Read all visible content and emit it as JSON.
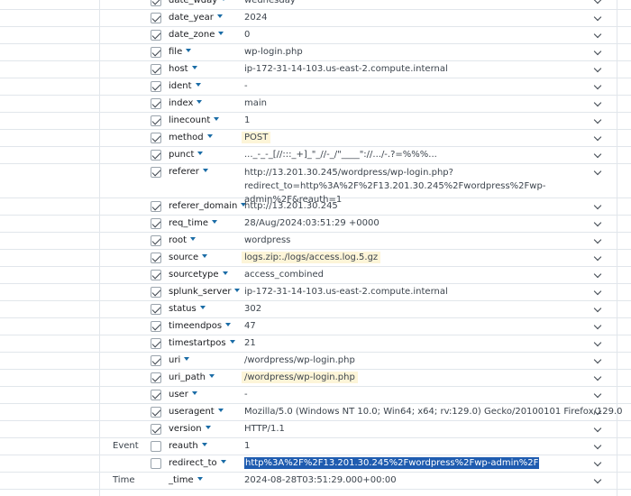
{
  "fields": [
    {
      "name": "date_wday",
      "value": "wednesday",
      "checked": true
    },
    {
      "name": "date_year",
      "value": "2024",
      "checked": true
    },
    {
      "name": "date_zone",
      "value": "0",
      "checked": true
    },
    {
      "name": "file",
      "value": "wp-login.php",
      "checked": true
    },
    {
      "name": "host",
      "value": "ip-172-31-14-103.us-east-2.compute.internal",
      "checked": true
    },
    {
      "name": "ident",
      "value": "-",
      "checked": true
    },
    {
      "name": "index",
      "value": "main",
      "checked": true
    },
    {
      "name": "linecount",
      "value": "1",
      "checked": true
    },
    {
      "name": "method",
      "value": "POST",
      "checked": true,
      "highlight": true
    },
    {
      "name": "punct",
      "value": "..._-_-_[//:::_+]_\"_//-_/\"____\"://.../-.?=%%%...",
      "checked": true
    },
    {
      "name": "referer",
      "value": "http://13.201.30.245/wordpress/wp-login.php?redirect_to=http%3A%2F%2F13.201.30.245%2Fwordpress%2Fwp-admin%2F&reauth=1",
      "checked": true,
      "tall": true
    },
    {
      "name": "referer_domain",
      "value": "http://13.201.30.245",
      "checked": true
    },
    {
      "name": "req_time",
      "value": "28/Aug/2024:03:51:29 +0000",
      "checked": true
    },
    {
      "name": "root",
      "value": "wordpress",
      "checked": true
    },
    {
      "name": "source",
      "value": "logs.zip:./logs/access.log.5.gz",
      "checked": true,
      "highlight": true
    },
    {
      "name": "sourcetype",
      "value": "access_combined",
      "checked": true
    },
    {
      "name": "splunk_server",
      "value": "ip-172-31-14-103.us-east-2.compute.internal",
      "checked": true
    },
    {
      "name": "status",
      "value": "302",
      "checked": true
    },
    {
      "name": "timeendpos",
      "value": "47",
      "checked": true
    },
    {
      "name": "timestartpos",
      "value": "21",
      "checked": true
    },
    {
      "name": "uri",
      "value": "/wordpress/wp-login.php",
      "checked": true
    },
    {
      "name": "uri_path",
      "value": "/wordpress/wp-login.php",
      "checked": true,
      "highlight": true
    },
    {
      "name": "user",
      "value": "-",
      "checked": true
    },
    {
      "name": "useragent",
      "value": "Mozilla/5.0 (Windows NT 10.0; Win64; x64; rv:129.0) Gecko/20100101 Firefox/129.0",
      "checked": true
    },
    {
      "name": "version",
      "value": "HTTP/1.1",
      "checked": true
    }
  ],
  "event_section": {
    "label": "Event",
    "fields": [
      {
        "name": "reauth",
        "value": "1",
        "checked": false
      },
      {
        "name": "redirect_to",
        "value": "http%3A%2F%2F13.201.30.245%2Fwordpress%2Fwp-admin%2F",
        "checked": false,
        "selected": true
      }
    ]
  },
  "time_section": {
    "label": "Time",
    "fields": [
      {
        "name": "_time",
        "value": "2024-08-28T03:51:29.000+00:00"
      }
    ]
  },
  "colors": {
    "caret": "#1a6ca6",
    "highlight": "#fdf5d8",
    "selection": "#1f5cb0"
  }
}
